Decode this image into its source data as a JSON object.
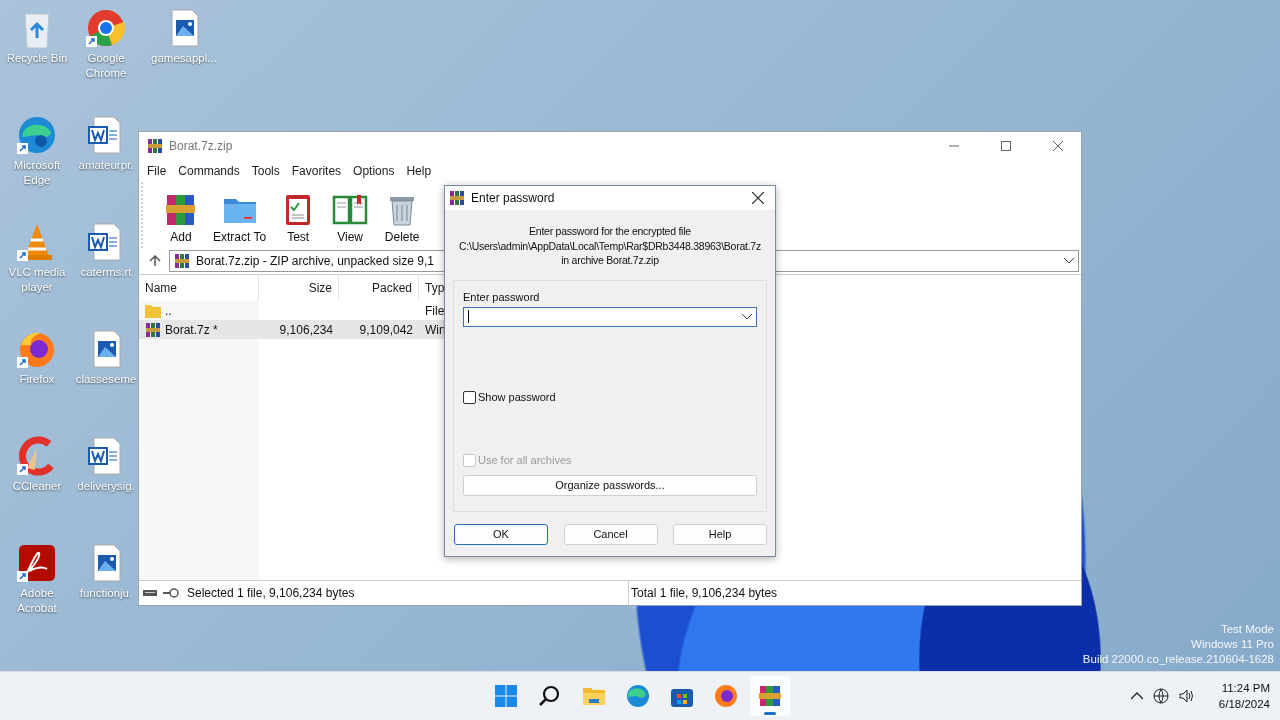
{
  "desktop_icons": [
    {
      "label": "Recycle Bin",
      "kind": "recycle",
      "shortcut": false
    },
    {
      "label": "Microsoft Edge",
      "kind": "edge",
      "shortcut": true
    },
    {
      "label": "VLC media player",
      "kind": "vlc",
      "shortcut": true
    },
    {
      "label": "Firefox",
      "kind": "firefox",
      "shortcut": true
    },
    {
      "label": "CCleaner",
      "kind": "ccleaner",
      "shortcut": true
    },
    {
      "label": "Adobe Acrobat",
      "kind": "acrobat",
      "shortcut": true
    },
    {
      "label": "Google Chrome",
      "kind": "chrome",
      "shortcut": true
    },
    {
      "label": "amateurpr.",
      "kind": "word",
      "shortcut": false
    },
    {
      "label": "caterms.rt",
      "kind": "word",
      "shortcut": false
    },
    {
      "label": "classeseme",
      "kind": "image",
      "shortcut": false
    },
    {
      "label": "deliverysig.",
      "kind": "word",
      "shortcut": false
    },
    {
      "label": "functionju.",
      "kind": "image",
      "shortcut": false
    },
    {
      "label": "gamesappl...",
      "kind": "image",
      "shortcut": false
    }
  ],
  "window": {
    "title": "Borat.7z.zip",
    "menu": [
      "File",
      "Commands",
      "Tools",
      "Favorites",
      "Options",
      "Help"
    ],
    "toolbar": [
      {
        "label": "Add",
        "kind": "add"
      },
      {
        "label": "Extract To",
        "kind": "extract"
      },
      {
        "label": "Test",
        "kind": "test"
      },
      {
        "label": "View",
        "kind": "view"
      },
      {
        "label": "Delete",
        "kind": "delete"
      }
    ],
    "address": "Borat.7z.zip - ZIP archive, unpacked size 9,1",
    "columns": [
      "Name",
      "Size",
      "Packed",
      "Typ"
    ],
    "rows": [
      {
        "kind": "folder",
        "name": "..",
        "type": "File",
        "selected": false
      },
      {
        "kind": "archive",
        "name": "Borat.7z *",
        "size": "9,106,234",
        "packed": "9,109,042",
        "type": "Win",
        "selected": true
      }
    ],
    "status_left": "Selected 1 file, 9,106,234 bytes",
    "status_right": "Total 1 file, 9,106,234 bytes"
  },
  "dialog": {
    "title": "Enter password",
    "message": [
      "Enter password for the encrypted file",
      "C:\\Users\\admin\\AppData\\Local\\Temp\\Rar$DRb3448.38963\\Borat.7z",
      "in archive Borat.7z.zip"
    ],
    "field_label": "Enter password",
    "checkboxes": [
      {
        "label": "Show password",
        "checked": false,
        "disabled": false
      },
      {
        "label": "Use for all archives",
        "checked": false,
        "disabled": true
      }
    ],
    "organize_button": "Organize passwords...",
    "buttons": [
      {
        "label": "OK",
        "default": true
      },
      {
        "label": "Cancel",
        "default": false
      },
      {
        "label": "Help",
        "default": false
      }
    ]
  },
  "watermark_text": [
    "Test Mode",
    "Windows 11 Pro",
    "Build 22000.co_release.210604-1628"
  ],
  "taskbar": {
    "apps": [
      {
        "kind": "start",
        "selected": false
      },
      {
        "kind": "search",
        "selected": false
      },
      {
        "kind": "explorer",
        "selected": false
      },
      {
        "kind": "edge",
        "selected": false
      },
      {
        "kind": "store",
        "selected": false
      },
      {
        "kind": "firefox",
        "selected": false
      },
      {
        "kind": "winrar",
        "selected": true
      }
    ],
    "time": "11:24 PM",
    "date": "6/18/2024"
  }
}
